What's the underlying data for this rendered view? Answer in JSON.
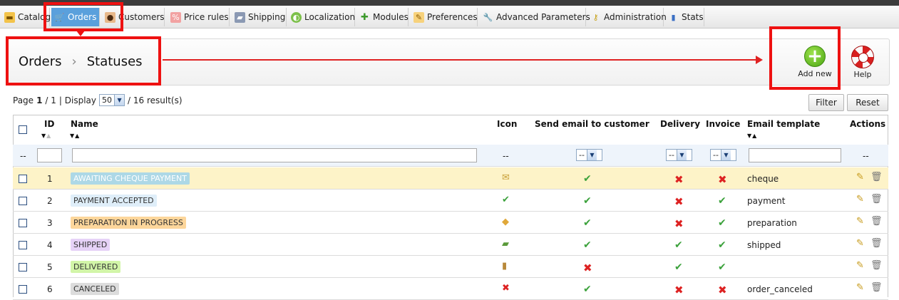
{
  "menu": {
    "tabs": [
      {
        "label": "Catalog",
        "icon": "folder-icon"
      },
      {
        "label": "Orders",
        "icon": "cart-icon"
      },
      {
        "label": "Customers",
        "icon": "user-icon"
      },
      {
        "label": "Price rules",
        "icon": "price-rules-icon"
      },
      {
        "label": "Shipping",
        "icon": "truck-icon"
      },
      {
        "label": "Localization",
        "icon": "globe-icon"
      },
      {
        "label": "Modules",
        "icon": "puzzle-icon"
      },
      {
        "label": "Preferences",
        "icon": "preferences-icon"
      },
      {
        "label": "Advanced Parameters",
        "icon": "wrench-icon"
      },
      {
        "label": "Administration",
        "icon": "key-icon"
      },
      {
        "label": "Stats",
        "icon": "bar-chart-icon"
      }
    ]
  },
  "breadcrumb": {
    "parent": "Orders",
    "separator": "›",
    "current": "Statuses"
  },
  "toolbar": {
    "add_label": "Add new",
    "help_label": "Help"
  },
  "pagination": {
    "page_label": "Page",
    "page": "1",
    "total_pages": "/ 1",
    "display_label": "| Display",
    "per_page": "50",
    "results": "/ 16 result(s)"
  },
  "filters": {
    "filter_label": "Filter",
    "reset_label": "Reset",
    "empty": "--",
    "select_value": "--"
  },
  "table": {
    "headers": {
      "id": "ID",
      "name": "Name",
      "icon": "Icon",
      "send_email": "Send email to customer",
      "delivery": "Delivery",
      "invoice": "Invoice",
      "email_template": "Email template",
      "actions": "Actions"
    },
    "rows": [
      {
        "id": "1",
        "name": "Awaiting cheque payment",
        "color": "#add8e6",
        "text_color": "#ffffff",
        "icon": "cheque-icon",
        "send_email": true,
        "delivery": false,
        "invoice": false,
        "template": "cheque"
      },
      {
        "id": "2",
        "name": "Payment accepted",
        "color": "#dfeef9",
        "text_color": "#333333",
        "icon": "check-icon",
        "send_email": true,
        "delivery": false,
        "invoice": true,
        "template": "payment"
      },
      {
        "id": "3",
        "name": "Preparation in progress",
        "color": "#fdd69b",
        "text_color": "#333333",
        "icon": "package-icon",
        "send_email": true,
        "delivery": false,
        "invoice": true,
        "template": "preparation"
      },
      {
        "id": "4",
        "name": "Shipped",
        "color": "#e6d2f7",
        "text_color": "#333333",
        "icon": "truck-icon",
        "send_email": true,
        "delivery": true,
        "invoice": true,
        "template": "shipped"
      },
      {
        "id": "5",
        "name": "Delivered",
        "color": "#d2f5a8",
        "text_color": "#333333",
        "icon": "box-icon",
        "send_email": false,
        "delivery": true,
        "invoice": true,
        "template": ""
      },
      {
        "id": "6",
        "name": "Canceled",
        "color": "#dcdcdc",
        "text_color": "#333333",
        "icon": "cross-icon",
        "send_email": true,
        "delivery": false,
        "invoice": false,
        "template": "order_canceled"
      }
    ]
  },
  "colors": {
    "highlight_row": "#fdf3c8",
    "filter_row": "#eef4fb",
    "annotation": "#ee1111",
    "active_tab": "#5aa0dc"
  }
}
